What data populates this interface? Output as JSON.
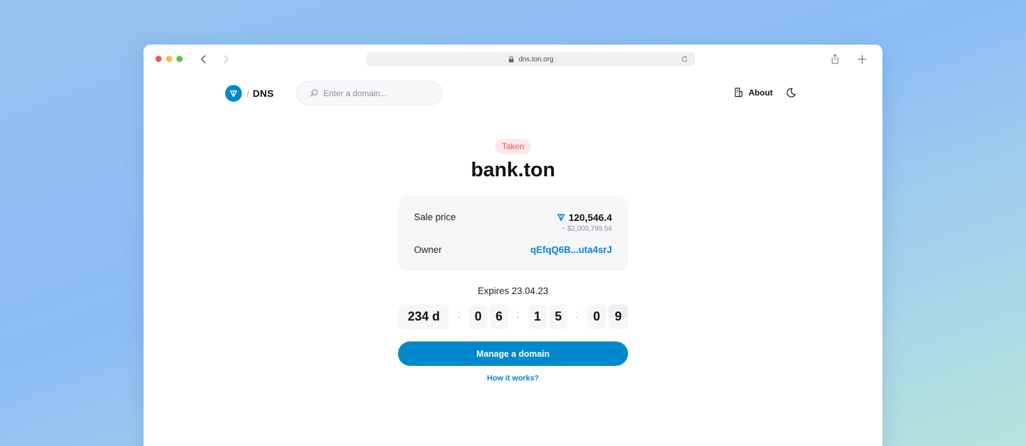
{
  "browser": {
    "url": "dns.ton.org"
  },
  "header": {
    "logo_separator": "/",
    "logo_text": "DNS",
    "search_placeholder": "Enter a domain...",
    "about_label": "About"
  },
  "domain": {
    "status": "Taken",
    "name": "bank.ton",
    "sale_price_label": "Sale price",
    "sale_price": "120,546.4",
    "sale_price_usd": "~ $2,000,799.54",
    "owner_label": "Owner",
    "owner": "qEfqQ6B...uta4srJ",
    "expires": "Expires 23.04.23"
  },
  "countdown": {
    "days": "234 d",
    "hours": [
      "0",
      "6"
    ],
    "minutes": [
      "1",
      "5"
    ],
    "seconds": [
      "0",
      "9"
    ],
    "separator": ":"
  },
  "actions": {
    "manage_label": "Manage a domain",
    "how_label": "How it works?"
  },
  "colors": {
    "accent": "#0088cc",
    "taken_badge_text": "#e8534e",
    "taken_badge_bg": "#fde9e9"
  }
}
